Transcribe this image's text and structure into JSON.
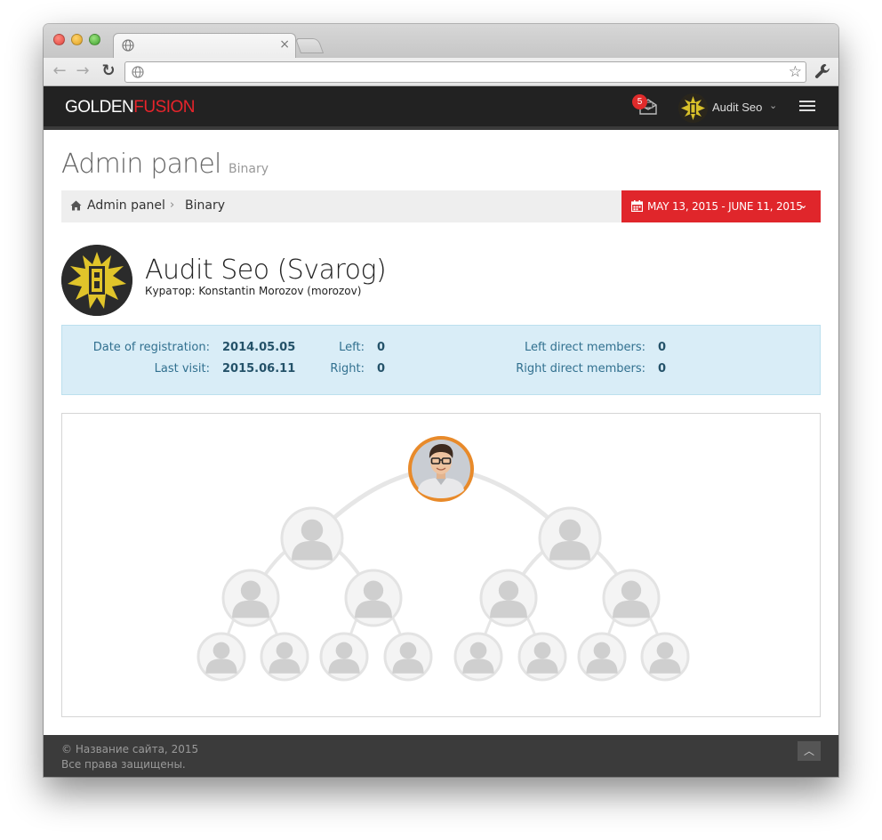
{
  "header": {
    "logo_part1": "GOLDEN",
    "logo_part2": "FUSION",
    "messages_count": "5",
    "user_name": "Audit Seo"
  },
  "page": {
    "title": "Admin panel",
    "subtitle": "Binary"
  },
  "breadcrumb": {
    "items": [
      {
        "label": "Admin panel"
      },
      {
        "label": "Binary"
      }
    ]
  },
  "daterange": {
    "label": "MAY 13, 2015 - JUNE 11, 2015"
  },
  "profile": {
    "name": "Audit Seo (Svarog)",
    "curator": "Куратор: Konstantin Morozov (morozov)"
  },
  "stats": {
    "reg_label": "Date of registration:",
    "reg_value": "2014.05.05",
    "visit_label": "Last visit:",
    "visit_value": "2015.06.11",
    "left_label": "Left:",
    "left_value": "0",
    "right_label": "Right:",
    "right_value": "0",
    "left_direct_label": "Left direct members:",
    "left_direct_value": "0",
    "right_direct_label": "Right direct members:",
    "right_direct_value": "0"
  },
  "footer": {
    "copyright": "© Название сайта, 2015",
    "rights": "Все права защищены."
  },
  "colors": {
    "brand_red": "#e0262b",
    "root_ring": "#e88a2a",
    "header_bg": "#222222",
    "info_bg": "#d9edf7"
  }
}
